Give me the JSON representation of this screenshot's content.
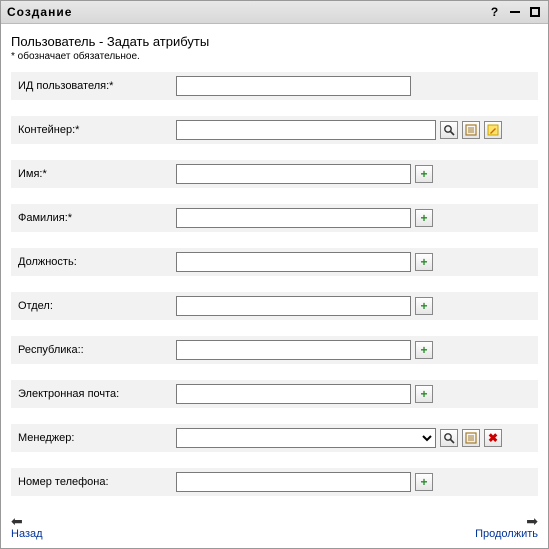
{
  "window": {
    "title": "Создание",
    "help": "?"
  },
  "header": {
    "subtitle": "Пользователь - Задать атрибуты",
    "required_note": "* обозначает обязательное."
  },
  "fields": {
    "user_id": {
      "label": "ИД пользователя:*",
      "value": ""
    },
    "container": {
      "label": "Контейнер:*",
      "value": ""
    },
    "first_name": {
      "label": "Имя:*",
      "value": ""
    },
    "last_name": {
      "label": "Фамилия:*",
      "value": ""
    },
    "job_title": {
      "label": "Должность:",
      "value": ""
    },
    "department": {
      "label": "Отдел:",
      "value": ""
    },
    "republic": {
      "label": "Республика::",
      "value": ""
    },
    "email": {
      "label": "Электронная почта:",
      "value": ""
    },
    "manager": {
      "label": "Менеджер:",
      "value": ""
    },
    "phone": {
      "label": "Номер телефона:",
      "value": ""
    }
  },
  "footer": {
    "back": "Назад",
    "continue": "Продолжить"
  }
}
